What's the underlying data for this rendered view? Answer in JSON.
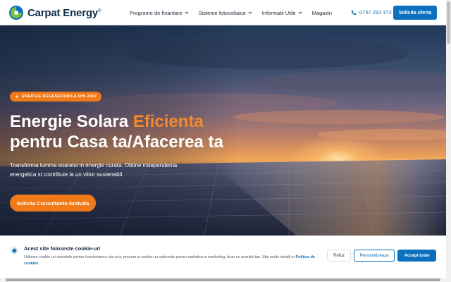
{
  "header": {
    "brand": "Carpat Energy",
    "brand_mark": "®",
    "nav": [
      {
        "label": "Programe de finantare",
        "has_dropdown": true
      },
      {
        "label": "Sisteme fotovoltaice",
        "has_dropdown": true
      },
      {
        "label": "Informatii Utile",
        "has_dropdown": true
      },
      {
        "label": "Magazin",
        "has_dropdown": false
      }
    ],
    "phone": "0757 291 372",
    "cta": "Solicita oferta"
  },
  "hero": {
    "badge": "ENERGIE REGENERABILA DIN 2007",
    "title_part1": "Energie Solara ",
    "title_accent": "Eficienta",
    "title_line2": "pentru Casa ta/Afacerea ta",
    "subtitle_line1": "Transforma lumina soarelui in energie curata. Obtine independenta",
    "subtitle_line2": "energetica si contribuie la un viitor sustenabil.",
    "cta": "Solicita Consultanta Gratuita"
  },
  "cookie": {
    "title": "Acest site foloseste cookie-uri",
    "text": "Utilizam cookie-uri esentiale pentru functionarea site-ului, precum si cookie-uri optionale pentru statistica si marketing, doar cu acordul tau. Mai multe detalii in",
    "link": "Politica de cookies",
    "btn_refuse": "Refuz",
    "btn_customize": "Personalizeaza",
    "btn_accept": "Accept toate"
  },
  "colors": {
    "primary_blue": "#0a70bf",
    "accent_orange": "#f07a1a",
    "logo_green": "#7bbf3a"
  }
}
